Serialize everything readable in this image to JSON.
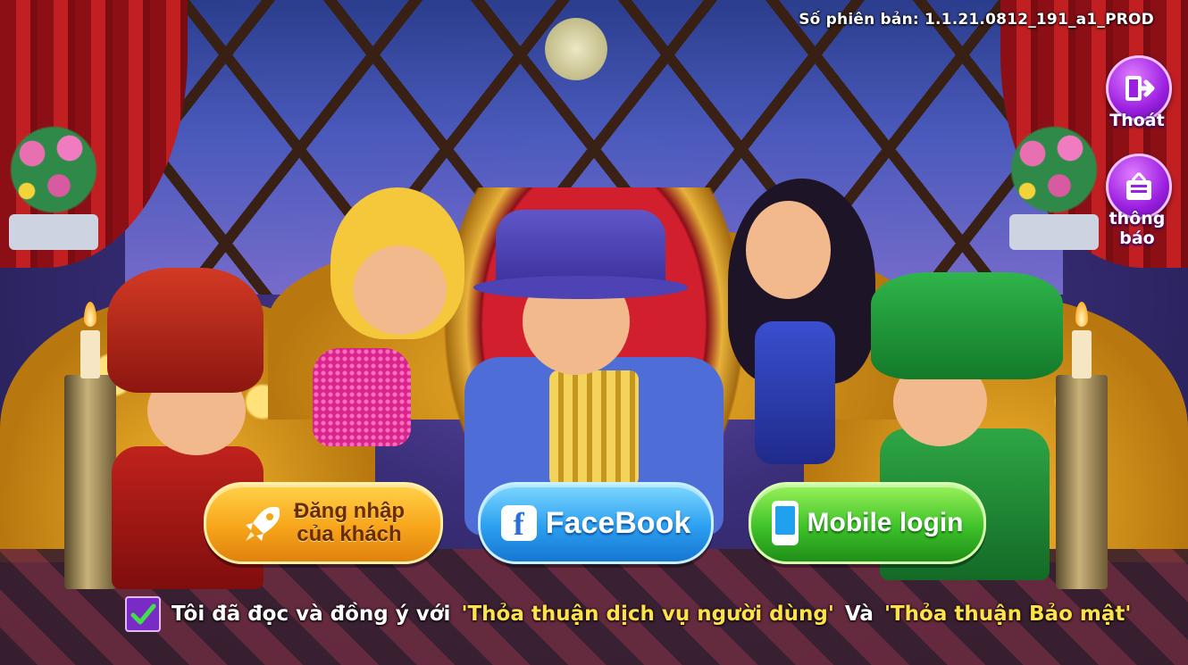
{
  "header": {
    "version_text": "Số phiên bản: 1.1.21.0812_191_a1_PROD"
  },
  "side_menu": {
    "exit_label": "Thoát",
    "notice_label": "thông báo"
  },
  "login": {
    "guest_line1": "Đăng nhập",
    "guest_line2": "của khách",
    "facebook_label": "FaceBook",
    "mobile_label": "Mobile login"
  },
  "agreement": {
    "prefix": "Tôi đã đọc và đồng ý với",
    "terms_link": "'Thỏa thuận dịch vụ người dùng'",
    "conjunction": "Và",
    "privacy_link": "'Thỏa thuận Bảo mật'",
    "checked": true
  },
  "icons": {
    "exit": "exit-door-icon",
    "notice": "notice-board-icon",
    "guest": "rocket-icon",
    "facebook": "facebook-icon",
    "mobile": "phone-icon",
    "check": "checkmark-icon"
  },
  "colors": {
    "guest_button": "#f7a51b",
    "facebook_button": "#2b9ff0",
    "mobile_button": "#3ec22a",
    "side_button": "#9b1fe0",
    "link_text": "#ffe24a"
  }
}
